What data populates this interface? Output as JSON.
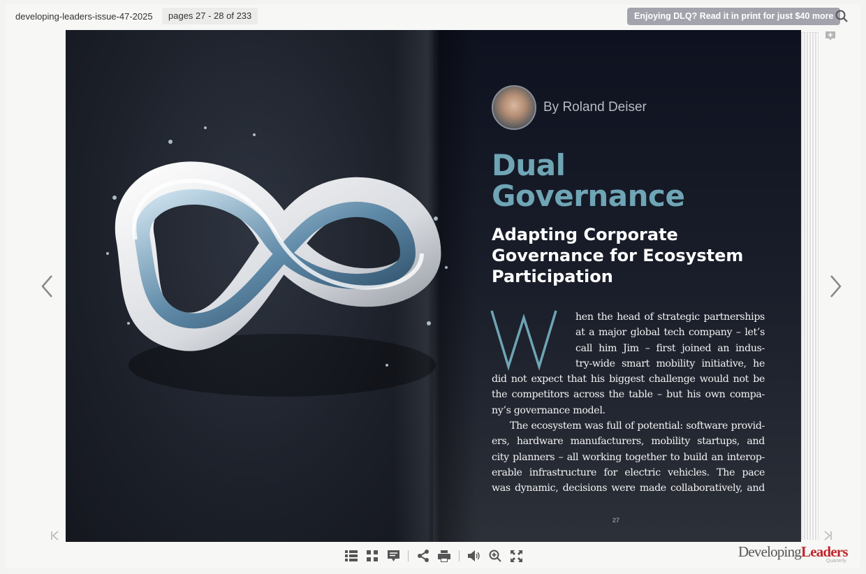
{
  "header": {
    "doc_title": "developing-leaders-issue-47-2025",
    "page_indicator": "pages 27 - 28 of 233",
    "promo_button": "Enjoying DLQ? Read it in print for just $40 more"
  },
  "article": {
    "author": "By Roland Deiser",
    "title_line1": "Dual",
    "title_line2": "Governance",
    "subtitle": "Adapting Corporate Governance for Ecosystem Participation",
    "drop_cap": "W",
    "lines": [
      "hen the head of strategic partnerships",
      "at a major global tech company – let’s",
      "call him Jim – first joined an indus-",
      "try-wide smart mobility initiative, he",
      "did not expect that his biggest challenge would not be",
      "the competitors across the table – but his own compa-",
      "ny’s governance model.",
      "The ecosystem was full of potential: software provid-",
      "ers, hardware manufacturers, mobility startups, and",
      "city planners – all working together to build an interop-",
      "erable infrastructure for electric vehicles. The pace",
      "was dynamic, decisions were made collaboratively, and"
    ],
    "page_number": "27"
  },
  "colors": {
    "title_accent": "#6fa5b5",
    "logo_red": "#c0262c"
  },
  "toolbar": {
    "icons": [
      "table-of-contents-icon",
      "thumbnails-icon",
      "notes-icon",
      "share-icon",
      "print-icon",
      "sound-icon",
      "zoom-in-icon",
      "fullscreen-icon"
    ]
  },
  "logo": {
    "part1": "Developing",
    "part2": "Leaders",
    "part3": "Quarterly"
  }
}
